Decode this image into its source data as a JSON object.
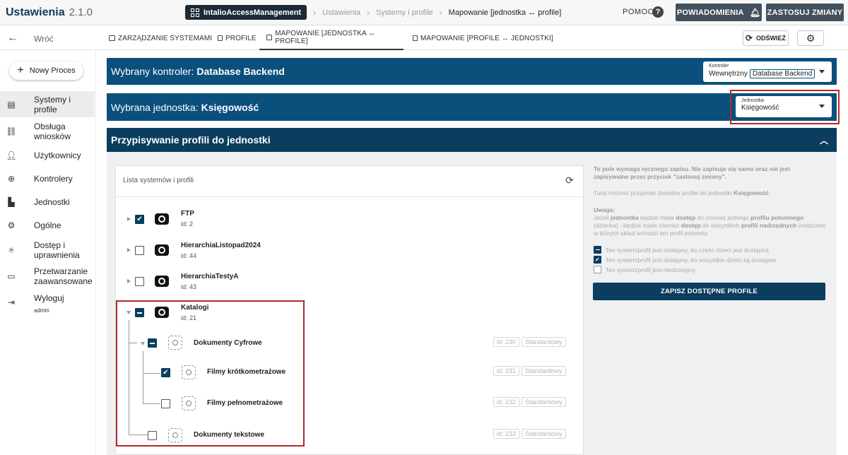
{
  "header": {
    "app_title": "Ustawienia",
    "version": "2.1.0",
    "breadcrumb": {
      "root": "IntalioAccessManagement",
      "items": [
        "Ustawienia",
        "Systemy i profile",
        "Mapowanie [jednostka ↔ profile]"
      ]
    },
    "help_label": "POMOC",
    "notifications_label": "POWIADOMIENIA",
    "apply_label": "ZASTOSUJ ZMIANY"
  },
  "nav": {
    "back_label": "Wróć",
    "tabs": [
      {
        "label": "ZARZĄDZANIE SYSTEMAMI",
        "active": false
      },
      {
        "label": "PROFILE",
        "active": false
      },
      {
        "label": "MAPOWANIE [JEDNOSTKA ↔ PROFILE]",
        "active": true
      },
      {
        "label": "MAPOWANIE [PROFILE ↔ JEDNOSTKI]",
        "active": false
      }
    ],
    "refresh_label": "ODŚWIEŻ"
  },
  "sidebar": {
    "new_process_label": "Nowy Proces",
    "items": [
      {
        "label": "Systemy i profile",
        "icon": "server-icon",
        "active": true
      },
      {
        "label": "Obsługa wniosków",
        "icon": "workflow-icon",
        "active": false
      },
      {
        "label": "Użytkownicy",
        "icon": "users-icon",
        "active": false
      },
      {
        "label": "Kontrolery",
        "icon": "globe-icon",
        "active": false
      },
      {
        "label": "Jednostki",
        "icon": "building-icon",
        "active": false
      },
      {
        "label": "Ogólne",
        "icon": "settings-box-icon",
        "active": false
      },
      {
        "label": "Dostęp i uprawnienia",
        "icon": "badge-icon",
        "active": false
      },
      {
        "label": "Przetwarzanie zaawansowane",
        "icon": "terminal-icon",
        "active": false
      },
      {
        "label": "Wyloguj",
        "sub": "admin",
        "icon": "logout-icon",
        "active": false
      }
    ]
  },
  "controller_banner": {
    "prefix": "Wybrany kontroler:",
    "name": "Database Backend",
    "select_label": "Kontroler",
    "select_value_prefix": "Wewnętrzny",
    "select_value_chip": "Database Backend"
  },
  "unit_banner": {
    "prefix": "Wybrana jednostka:",
    "name": "Księgowość",
    "select_label": "Jednostka",
    "select_value": "Księgowość"
  },
  "section": {
    "title": "Przypisywanie profili do jednostki",
    "tree_title": "Lista systemów i profili",
    "tree": [
      {
        "name": "FTP",
        "id": "id: 2",
        "state": "checked"
      },
      {
        "name": "HierarchiaListopad2024",
        "id": "id: 44",
        "state": "unchecked"
      },
      {
        "name": "HierarchiaTestyA",
        "id": "id: 43",
        "state": "unchecked"
      },
      {
        "name": "Katalogi",
        "id": "id: 21",
        "state": "partial"
      }
    ],
    "profiles": [
      {
        "name": "Dokumenty Cyfrowe",
        "id": "id: 230",
        "type": "Standardowy",
        "state": "partial"
      },
      {
        "name": "Filmy krótkometrażowe",
        "id": "id: 231",
        "type": "Standardowy",
        "state": "checked"
      },
      {
        "name": "Filmy pełnometrażowe",
        "id": "id: 232",
        "type": "Standardowy",
        "state": "unchecked"
      },
      {
        "name": "Dokumenty tekstowe",
        "id": "id: 233",
        "type": "Standardowy",
        "state": "unchecked"
      }
    ]
  },
  "info": {
    "warning": "To pole wymaga ręcznego zapisu. Nie zapisuje się samo oraz nie jest zapisywalne przez przycisk \"zastosuj zmiany\".",
    "assign_text": "Tutaj możesz przypisać dowolne profile do jednostki",
    "assign_unit": "Księgowość",
    "note_title": "Uwaga:",
    "note_part1": "Jeżeli",
    "note_b1": "jednostka",
    "note_part2": "będzie miała",
    "note_b2": "dostęp",
    "note_part3": "do chociaż jednego",
    "note_b3": "profilu potomnego",
    "note_part4": "(dziecka) - będzie miała również",
    "note_b4": "dostęp",
    "note_part5": "do wszystkich",
    "note_b5": "profili nadrzędnych",
    "note_part6": "(rodziców) w których skład wchodzi ten profil potomny.",
    "legend": [
      {
        "state": "partial",
        "text": "Ten system/profil jest dostępny, bo część dzieci jest dostępna"
      },
      {
        "state": "checked",
        "text": "Ten system/profil jest dostępny, bo wszystkie dzieci są dostępne"
      },
      {
        "state": "unchecked",
        "text": "Ten system/profil jest niedostępny"
      }
    ],
    "save_label": "ZAPISZ DOSTĘPNE PROFILE"
  }
}
